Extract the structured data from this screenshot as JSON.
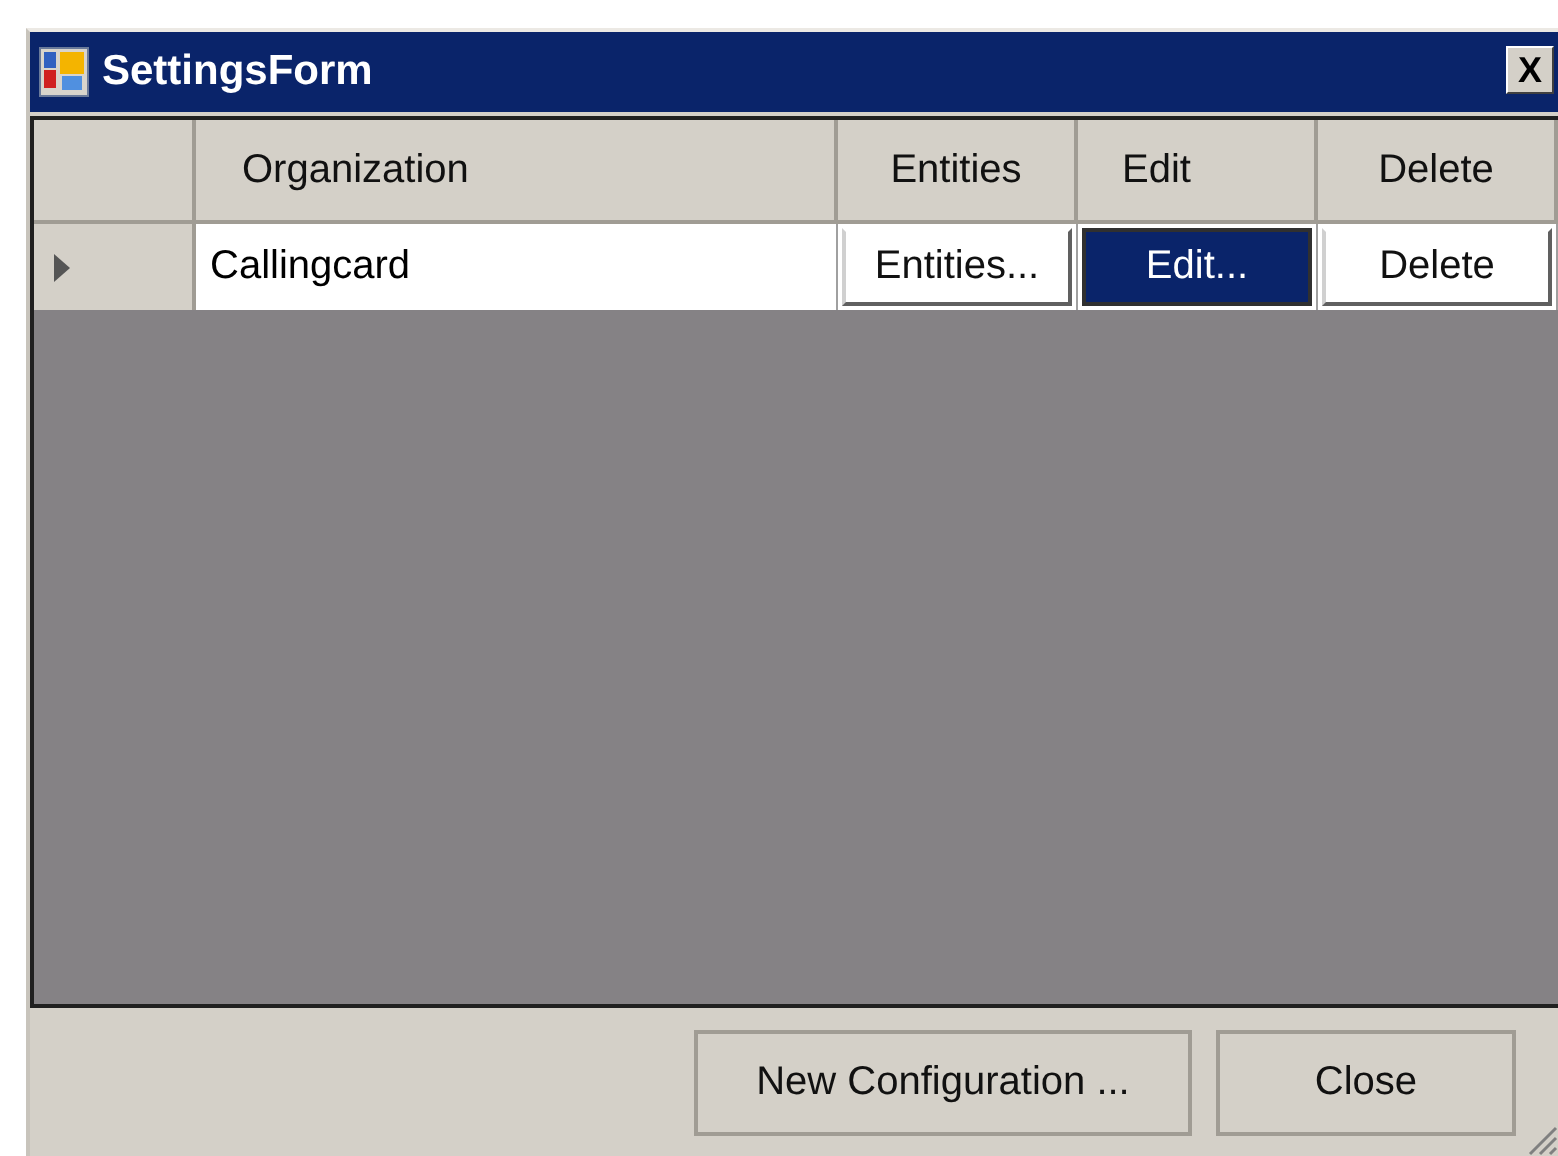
{
  "window": {
    "title": "SettingsForm",
    "close_glyph": "X"
  },
  "grid": {
    "columns": [
      {
        "label": "Organization"
      },
      {
        "label": "Entities"
      },
      {
        "label": "Edit"
      },
      {
        "label": "Delete"
      }
    ],
    "rows": [
      {
        "current": true,
        "organization": "Callingcard",
        "buttons": [
          {
            "label": "Entities...",
            "selected": false
          },
          {
            "label": "Edit...",
            "selected": true
          },
          {
            "label": "Delete",
            "selected": false
          }
        ]
      }
    ]
  },
  "buttons": [
    {
      "label": "New Configuration ..."
    },
    {
      "label": "Close"
    }
  ]
}
